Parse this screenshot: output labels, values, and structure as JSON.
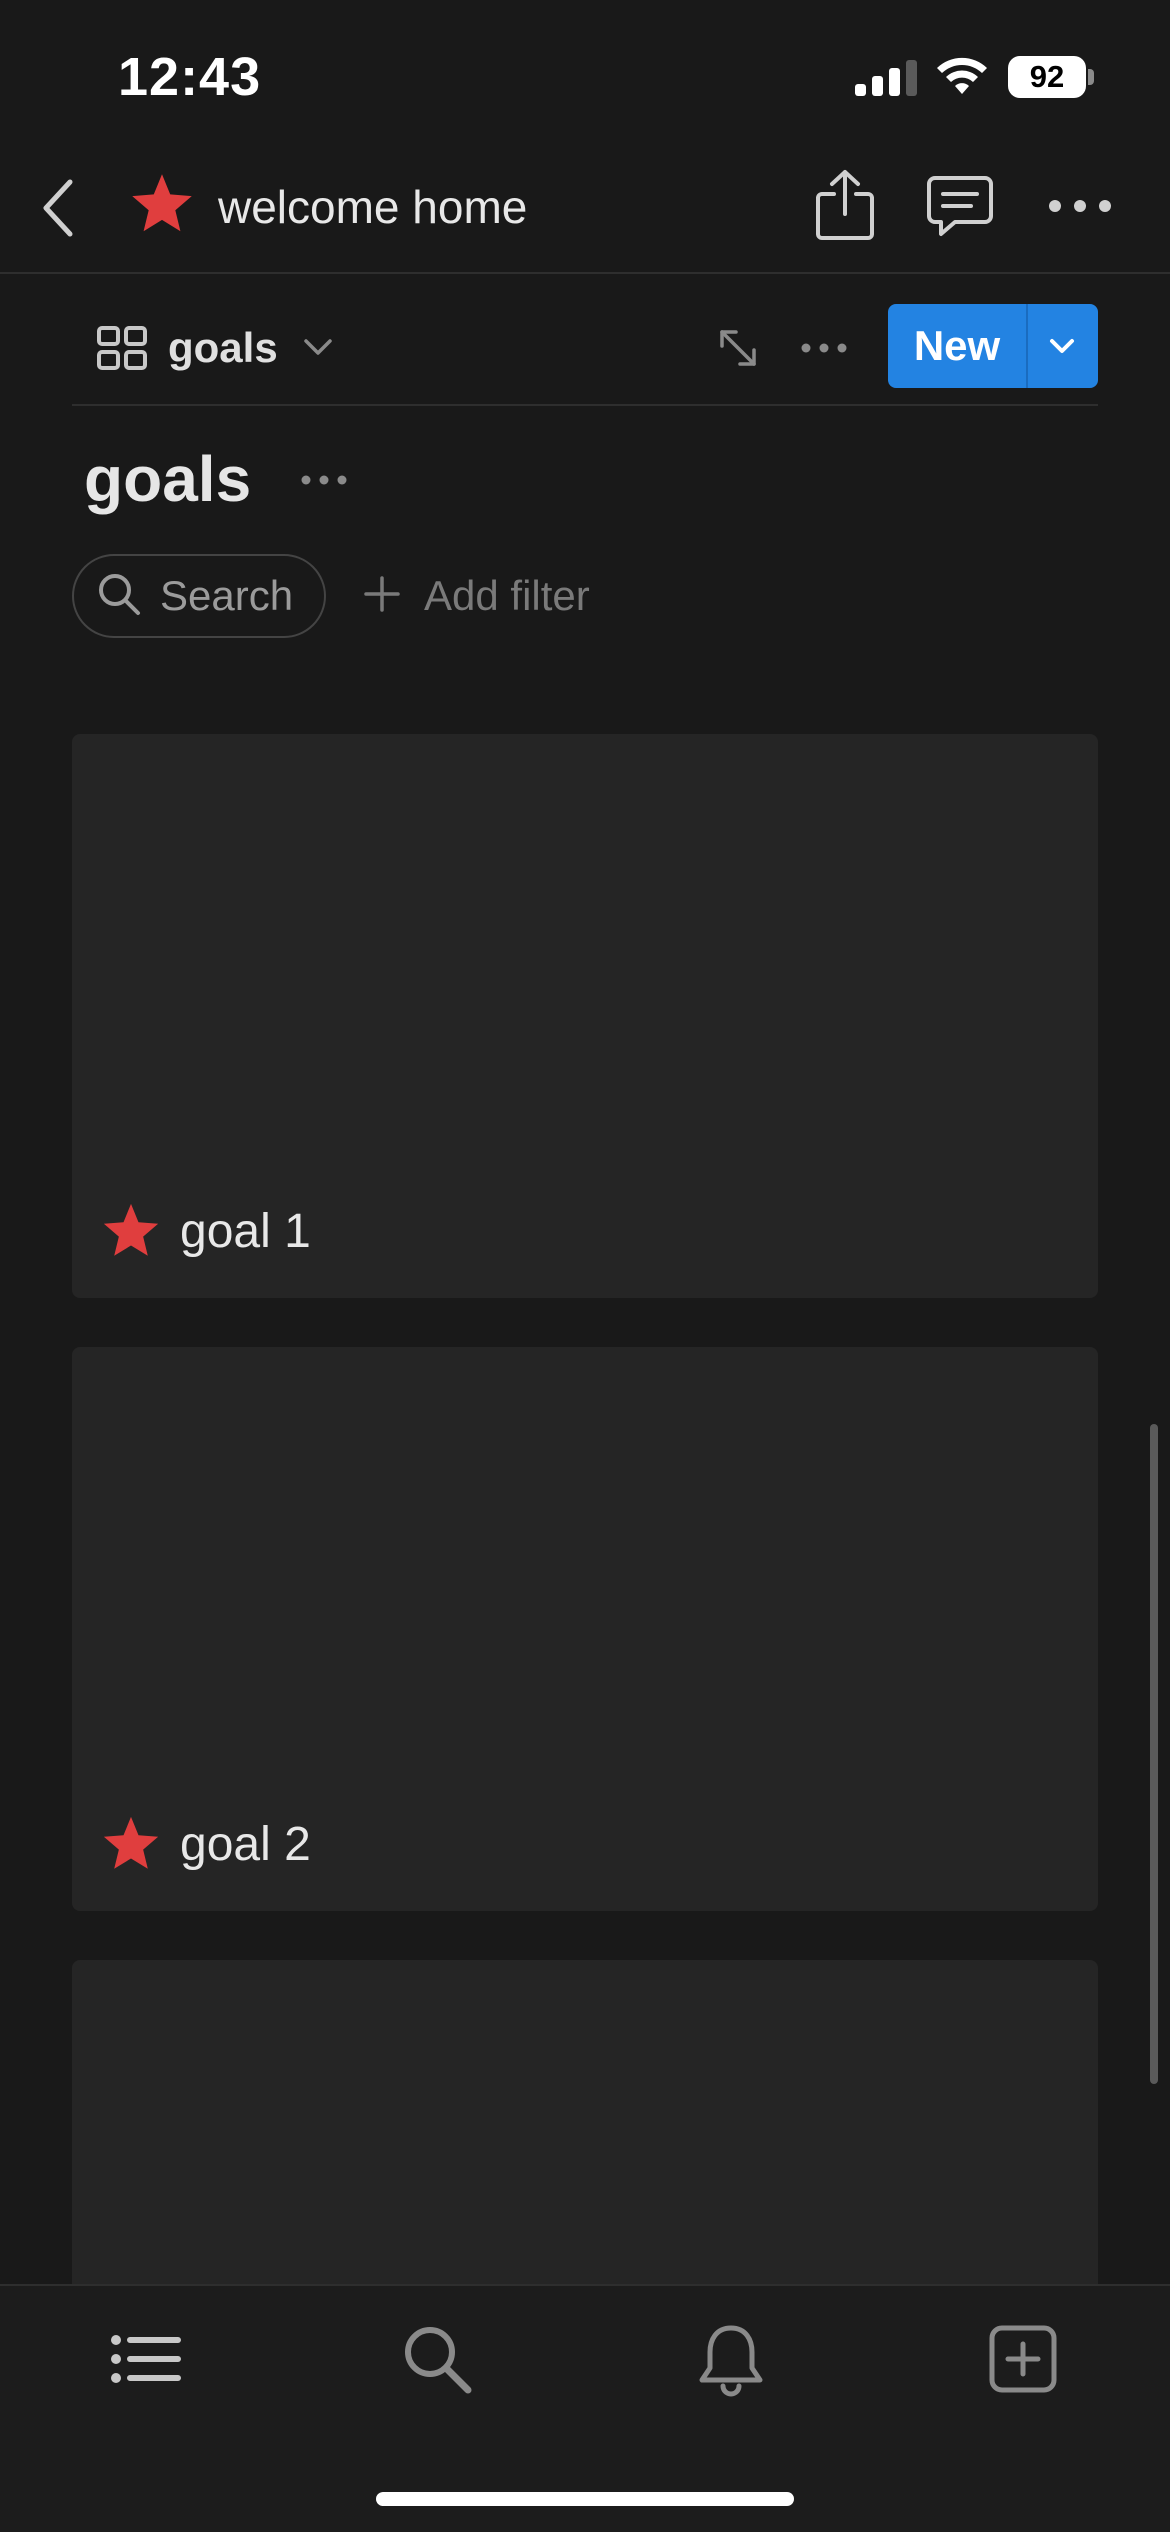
{
  "status_bar": {
    "time": "12:43",
    "battery": "92"
  },
  "nav": {
    "page_title": "welcome home",
    "icons": [
      "back-icon",
      "star-icon",
      "share-icon",
      "comment-icon",
      "more-icon"
    ]
  },
  "view": {
    "name": "goals",
    "new_label": "New"
  },
  "database": {
    "title": "goals",
    "search_label": "Search",
    "filter_label": "Add filter"
  },
  "cards": [
    {
      "label": "goal 1"
    },
    {
      "label": "goal 2"
    },
    {
      "label": ""
    }
  ],
  "tabbar": {
    "icons": [
      "list-icon",
      "search-icon",
      "bell-icon",
      "new-page-icon"
    ]
  },
  "colors": {
    "background": "#191919",
    "card": "#252525",
    "accent": "#2383e2",
    "star": "#e03e3e"
  }
}
